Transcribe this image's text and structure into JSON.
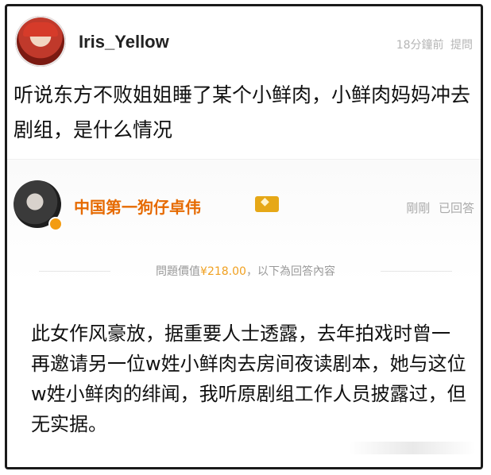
{
  "question": {
    "username": "Iris_Yellow",
    "time": "18分鐘前",
    "action": "提問",
    "text": "听说东方不败姐姐睡了某个小鲜肉，小鲜肉妈妈冲去剧组，是什么情况"
  },
  "answer": {
    "username": "中国第一狗仔卓伟",
    "time": "剛剛",
    "status": "已回答",
    "price_label": "問題價值",
    "price": "¥218.00",
    "price_suffix": "，以下為回答內容",
    "text": "此女作风豪放，据重要人士透露，去年拍戏时曾一再邀请另一位w姓小鲜肉去房间夜读剧本，她与这位w姓小鲜肉的绯闻，我听原剧组工作人员披露过，但无实据。"
  },
  "colors": {
    "answer_name": "#e66a00",
    "price": "#f0a020",
    "meta": "#aaaaaa"
  }
}
